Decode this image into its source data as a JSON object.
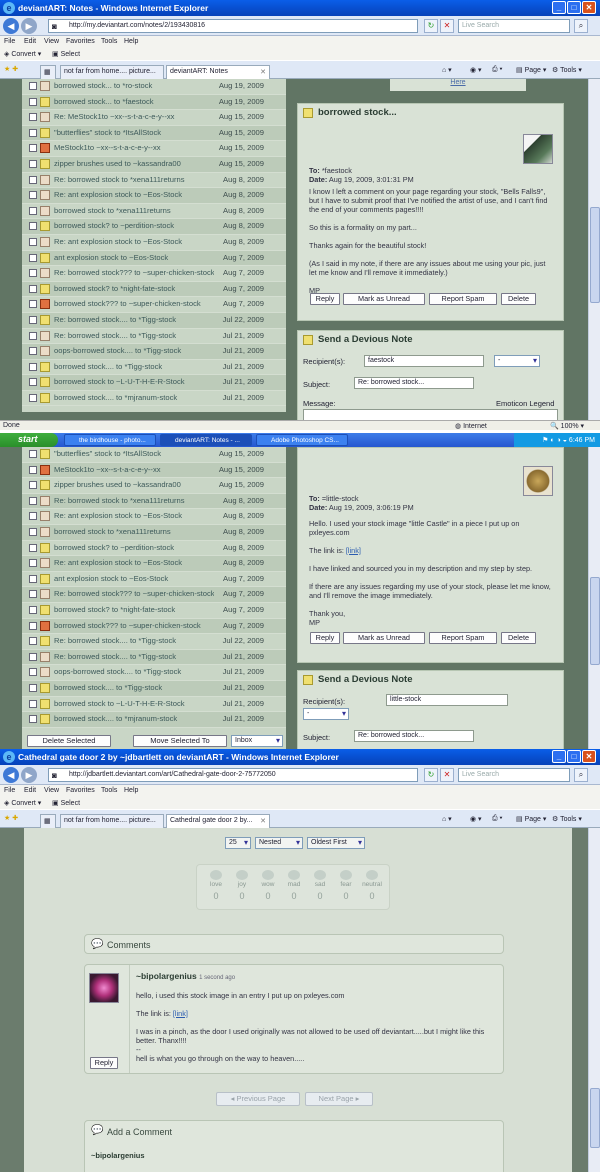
{
  "screen1": {
    "window_title": "deviantART: Notes - Windows Internet Explorer",
    "url": "http://my.deviantart.com/notes/2/193430816",
    "search_placeholder": "Live Search",
    "menu": [
      "File",
      "Edit",
      "View",
      "Favorites",
      "Tools",
      "Help"
    ],
    "toolbar_convert": "Convert",
    "toolbar_select": "Select",
    "tab_1": "not far from home.... picture...",
    "tab_2": "deviantART: Notes",
    "tool_page": "Page",
    "tool_tools": "Tools",
    "link_here": "Here",
    "notes": [
      {
        "icon": "reply",
        "subject": "borrowed stock... to *ro-stock",
        "date": "Aug 19, 2009"
      },
      {
        "icon": "note",
        "subject": "borrowed stock... to *faestock",
        "date": "Aug 19, 2009"
      },
      {
        "icon": "reply",
        "subject": "Re: MeStock1to ~xx--s-t-a-c-e-y--xx",
        "date": "Aug 15, 2009"
      },
      {
        "icon": "note",
        "subject": "\"butterflies\" stock to *ItsAllStock",
        "date": "Aug 15, 2009"
      },
      {
        "icon": "dev",
        "subject": "MeStock1to ~xx--s-t-a-c-e-y--xx",
        "date": "Aug 15, 2009"
      },
      {
        "icon": "note",
        "subject": "zipper brushes used to ~kassandra00",
        "date": "Aug 15, 2009"
      },
      {
        "icon": "reply",
        "subject": "Re: borrowed stock to *xena111returns",
        "date": "Aug 8, 2009"
      },
      {
        "icon": "reply",
        "subject": "Re: ant explosion stock to ~Eos-Stock",
        "date": "Aug 8, 2009"
      },
      {
        "icon": "reply",
        "subject": "borrowed stock to *xena111returns",
        "date": "Aug 8, 2009"
      },
      {
        "icon": "note",
        "subject": "borrowed stock? to ~perdition-stock",
        "date": "Aug 8, 2009"
      },
      {
        "icon": "reply",
        "subject": "Re: ant explosion stock to ~Eos-Stock",
        "date": "Aug 8, 2009"
      },
      {
        "icon": "note",
        "subject": "ant explosion stock to ~Eos-Stock",
        "date": "Aug 7, 2009"
      },
      {
        "icon": "reply",
        "subject": "Re: borrowed stock??? to ~super-chicken-stock",
        "date": "Aug 7, 2009"
      },
      {
        "icon": "note",
        "subject": "borrowed stock? to *night-fate-stock",
        "date": "Aug 7, 2009"
      },
      {
        "icon": "dev",
        "subject": "borrowed stock??? to ~super-chicken-stock",
        "date": "Aug 7, 2009"
      },
      {
        "icon": "note",
        "subject": "Re: borrowed stock.... to *Tigg-stock",
        "date": "Jul 22, 2009"
      },
      {
        "icon": "reply",
        "subject": "Re: borrowed stock.... to *Tigg-stock",
        "date": "Jul 21, 2009"
      },
      {
        "icon": "reply",
        "subject": "oops-borrowed stock.... to *Tigg-stock",
        "date": "Jul 21, 2009"
      },
      {
        "icon": "note",
        "subject": "borrowed stock.... to *Tigg-stock",
        "date": "Jul 21, 2009"
      },
      {
        "icon": "note",
        "subject": "borrowed stock to ~L-U-T-H-E-R-Stock",
        "date": "Jul 21, 2009"
      },
      {
        "icon": "note",
        "subject": "borrowed stock.... to *mjranum-stock",
        "date": "Jul 21, 2009"
      }
    ],
    "note_title": "borrowed stock...",
    "to_label": "To:",
    "to": "*faestock",
    "date_label": "Date:",
    "date": "Aug 19, 2009, 3:01:31 PM",
    "body": [
      "I know I left a comment on your page regarding your stock, \"Bells Falls9\", but I have to submit proof that I've notified the artist of use, and I can't find the end of your comments pages!!!!",
      "So this is a formality on my part...",
      "Thanks again for the beautiful stock!",
      "(As I said in my note, if there are any issues about me using your pic, just let me know and I'll remove it immediately.)",
      "MP"
    ],
    "btn_reply": "Reply",
    "btn_unread": "Mark as Unread",
    "btn_spam": "Report Spam",
    "btn_delete": "Delete",
    "send_title": "Send a Devious Note",
    "recipient_label": "Recipient(s):",
    "recipient": "faestock",
    "folder_select": "-",
    "subject_label": "Subject:",
    "subject": "Re: borrowed stock...",
    "message_label": "Message:",
    "emoticon": "Emoticon Legend",
    "status_left": "Done",
    "status_zone": "Internet",
    "status_zoom": "100%"
  },
  "taskbar": {
    "start": "start",
    "tasks": [
      "the birdhouse - photo...",
      "deviantART: Notes - ...",
      "Adobe Photoshop CS..."
    ],
    "clock": "6:46 PM"
  },
  "screen2": {
    "notes": [
      {
        "icon": "note",
        "subject": "\"butterflies\" stock to *ItsAllStock",
        "date": "Aug 15, 2009"
      },
      {
        "icon": "dev",
        "subject": "MeStock1to ~xx--s-t-a-c-e-y--xx",
        "date": "Aug 15, 2009"
      },
      {
        "icon": "note",
        "subject": "zipper brushes used to ~kassandra00",
        "date": "Aug 15, 2009"
      },
      {
        "icon": "reply",
        "subject": "Re: borrowed stock to *xena111returns",
        "date": "Aug 8, 2009"
      },
      {
        "icon": "reply",
        "subject": "Re: ant explosion stock to ~Eos-Stock",
        "date": "Aug 8, 2009"
      },
      {
        "icon": "reply",
        "subject": "borrowed stock to *xena111returns",
        "date": "Aug 8, 2009"
      },
      {
        "icon": "note",
        "subject": "borrowed stock? to ~perdition-stock",
        "date": "Aug 8, 2009"
      },
      {
        "icon": "reply",
        "subject": "Re: ant explosion stock to ~Eos-Stock",
        "date": "Aug 8, 2009"
      },
      {
        "icon": "note",
        "subject": "ant explosion stock to ~Eos-Stock",
        "date": "Aug 7, 2009"
      },
      {
        "icon": "reply",
        "subject": "Re: borrowed stock??? to ~super-chicken-stock",
        "date": "Aug 7, 2009"
      },
      {
        "icon": "note",
        "subject": "borrowed stock? to *night-fate-stock",
        "date": "Aug 7, 2009"
      },
      {
        "icon": "dev",
        "subject": "borrowed stock??? to ~super-chicken-stock",
        "date": "Aug 7, 2009"
      },
      {
        "icon": "note",
        "subject": "Re: borrowed stock.... to *Tigg-stock",
        "date": "Jul 22, 2009"
      },
      {
        "icon": "reply",
        "subject": "Re: borrowed stock.... to *Tigg-stock",
        "date": "Jul 21, 2009"
      },
      {
        "icon": "reply",
        "subject": "oops-borrowed stock.... to *Tigg-stock",
        "date": "Jul 21, 2009"
      },
      {
        "icon": "note",
        "subject": "borrowed stock.... to *Tigg-stock",
        "date": "Jul 21, 2009"
      },
      {
        "icon": "note",
        "subject": "borrowed stock to ~L-U-T-H-E-R-Stock",
        "date": "Jul 21, 2009"
      },
      {
        "icon": "note",
        "subject": "borrowed stock.... to *mjranum-stock",
        "date": "Jul 21, 2009"
      }
    ],
    "delete_selected": "Delete Selected",
    "move_selected": "Move Selected To",
    "inbox": "Inbox",
    "to": "=little-stock",
    "date": "Aug 19, 2009, 3:06:19 PM",
    "body1": "Hello. I used your stock image \"little Castle\" in a piece I put up on pxleyes.com",
    "link_prefix": "The link is:",
    "link": "[link]",
    "body2": "I have linked and sourced you in my description and my step by step.",
    "body3": "If there are any issues regarding my use of your stock, please let me know, and I'll remove the image immediately.",
    "body4": "Thank you,",
    "body5": "MP",
    "recipient": "little-stock",
    "subject": "Re: borrowed stock..."
  },
  "screen3": {
    "window_title": "Cathedral gate door 2 by ~jdbartlett on deviantART - Windows Internet Explorer",
    "url": "http://jdbartlett.deviantart.com/art/Cathedral-gate-door-2-75772050",
    "tab_2": "Cathedral gate door 2 by...",
    "per_page": "25",
    "nested": "Nested",
    "order": "Oldest First",
    "reactions": [
      {
        "label": "love",
        "count": "0"
      },
      {
        "label": "joy",
        "count": "0"
      },
      {
        "label": "wow",
        "count": "0"
      },
      {
        "label": "mad",
        "count": "0"
      },
      {
        "label": "sad",
        "count": "0"
      },
      {
        "label": "fear",
        "count": "0"
      },
      {
        "label": "neutral",
        "count": "0"
      }
    ],
    "comments_title": "Comments",
    "commenter": "~bipolargenius",
    "comment_time": "1 second ago",
    "c1": "hello, i used this stock image in an entry I put up on pxleyes.com",
    "c2_prefix": "The link is:",
    "c2_link": "[link]",
    "c3": "I was in a pinch, as the door I used originally was not allowed to be used off deviantart.....but I might like this better. Thanx!!!!",
    "c4": "--",
    "c5": "hell is what you go through on the way to heaven.....",
    "reply": "Reply",
    "prev": "Previous Page",
    "next": "Next Page",
    "add_title": "Add a Comment",
    "add_user": "~bipolargenius"
  }
}
